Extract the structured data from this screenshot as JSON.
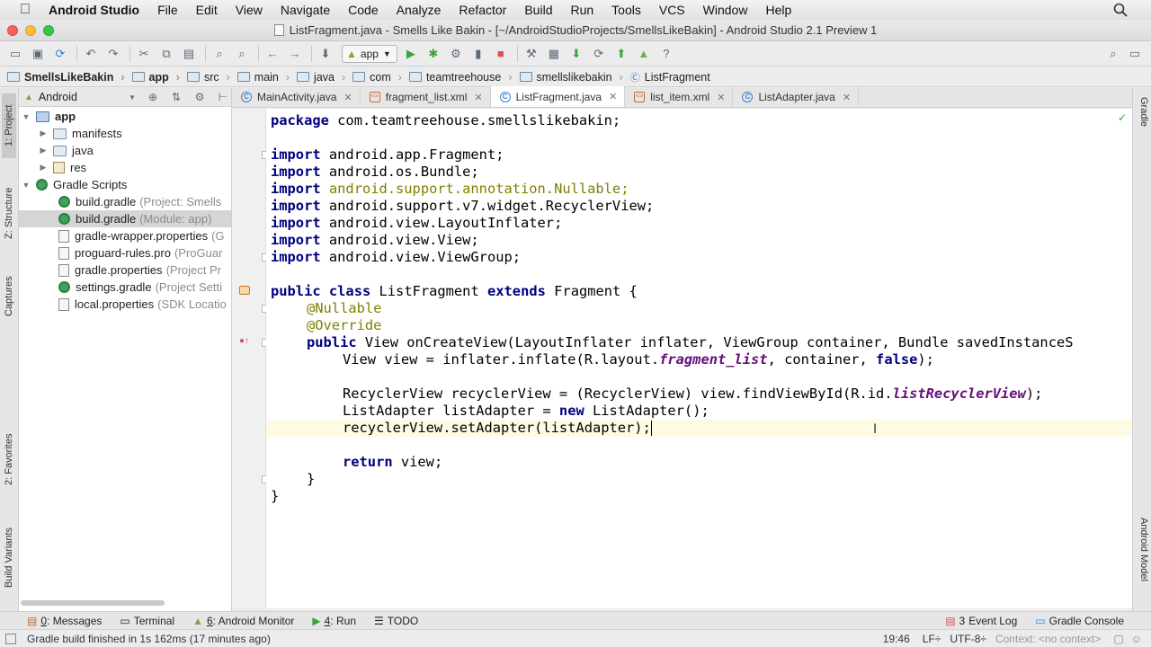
{
  "menubar": {
    "app": "Android Studio",
    "items": [
      "File",
      "Edit",
      "View",
      "Navigate",
      "Code",
      "Analyze",
      "Refactor",
      "Build",
      "Run",
      "Tools",
      "VCS",
      "Window",
      "Help"
    ]
  },
  "window": {
    "title": "ListFragment.java - Smells Like Bakin - [~/AndroidStudioProjects/SmellsLikeBakin] - Android Studio 2.1 Preview 1"
  },
  "toolbar": {
    "run_config": "app"
  },
  "breadcrumb": [
    "SmellsLikeBakin",
    "app",
    "src",
    "main",
    "java",
    "com",
    "teamtreehouse",
    "smellslikebakin",
    "ListFragment"
  ],
  "project": {
    "view_selector": "Android",
    "tree": [
      {
        "label": "app",
        "note": "",
        "kind": "app"
      },
      {
        "label": "manifests",
        "note": "",
        "kind": "folder"
      },
      {
        "label": "java",
        "note": "",
        "kind": "folder"
      },
      {
        "label": "res",
        "note": "",
        "kind": "res"
      },
      {
        "label": "Gradle Scripts",
        "note": "",
        "kind": "gradle-root"
      },
      {
        "label": "build.gradle",
        "note": "(Project: Smells",
        "kind": "gradle"
      },
      {
        "label": "build.gradle",
        "note": "(Module: app)",
        "kind": "gradle"
      },
      {
        "label": "gradle-wrapper.properties",
        "note": "(G",
        "kind": "prop"
      },
      {
        "label": "proguard-rules.pro",
        "note": "(ProGuar",
        "kind": "prop"
      },
      {
        "label": "gradle.properties",
        "note": "(Project Pr",
        "kind": "prop"
      },
      {
        "label": "settings.gradle",
        "note": "(Project Setti",
        "kind": "gradle"
      },
      {
        "label": "local.properties",
        "note": "(SDK Locatio",
        "kind": "prop"
      }
    ]
  },
  "tabs": [
    {
      "label": "MainActivity.java",
      "type": "class"
    },
    {
      "label": "fragment_list.xml",
      "type": "xml"
    },
    {
      "label": "ListFragment.java",
      "type": "class"
    },
    {
      "label": "list_item.xml",
      "type": "xml"
    },
    {
      "label": "ListAdapter.java",
      "type": "class"
    }
  ],
  "code": {
    "l1": "com.teamtreehouse.smellslikebakin;",
    "imports": [
      "android.app.Fragment;",
      "android.os.Bundle;",
      "android.support.annotation.Nullable;",
      "android.support.v7.widget.RecyclerView;",
      "android.view.LayoutInflater;",
      "android.view.View;",
      "android.view.ViewGroup;"
    ],
    "class_name": "ListFragment",
    "super": "Fragment {",
    "a1": "@Nullable",
    "a2": "@Override",
    "method": "View onCreateView(LayoutInflater inflater, ViewGroup container, Bundle savedInstanceS",
    "l_view_a": "View view = inflater.inflate(R.layout.",
    "l_view_b": "fragment_list",
    "l_view_c": ", container, ",
    "l_view_d": "false",
    "l_view_e": ");",
    "l_rv_a": "RecyclerView recyclerView = (RecyclerView) view.findViewById(R.id.",
    "l_rv_b": "listRecyclerView",
    "l_rv_c": ");",
    "l_la_a": "ListAdapter listAdapter = ",
    "l_la_b": "new",
    "l_la_c": " ListAdapter();",
    "l_set": "recyclerView.setAdapter(listAdapter);",
    "l_ret": " view;",
    "kw_package": "package",
    "kw_import": "import",
    "kw_public": "public",
    "kw_class": "class",
    "kw_extends": "extends",
    "kw_return": "return",
    "close1": "}",
    "close2": "}"
  },
  "side_tabs": {
    "left": [
      "1: Project",
      "Z: Structure",
      "Captures",
      "2: Favorites",
      "Build Variants"
    ],
    "right": [
      "Gradle",
      "Android Model"
    ]
  },
  "bottom_tools": [
    {
      "num": "0",
      "label": ": Messages"
    },
    {
      "num": "",
      "label": "Terminal"
    },
    {
      "num": "6",
      "label": ": Android Monitor"
    },
    {
      "num": "4",
      "label": ": Run"
    },
    {
      "num": "",
      "label": "TODO"
    }
  ],
  "bottom_right": [
    "Event Log",
    "Gradle Console"
  ],
  "event_count": "3",
  "status": {
    "message": "Gradle build finished in 1s 162ms (17 minutes ago)",
    "position": "19:46",
    "line_sep": "LF÷",
    "encoding": "UTF-8÷",
    "context": "Context: <no context>"
  }
}
